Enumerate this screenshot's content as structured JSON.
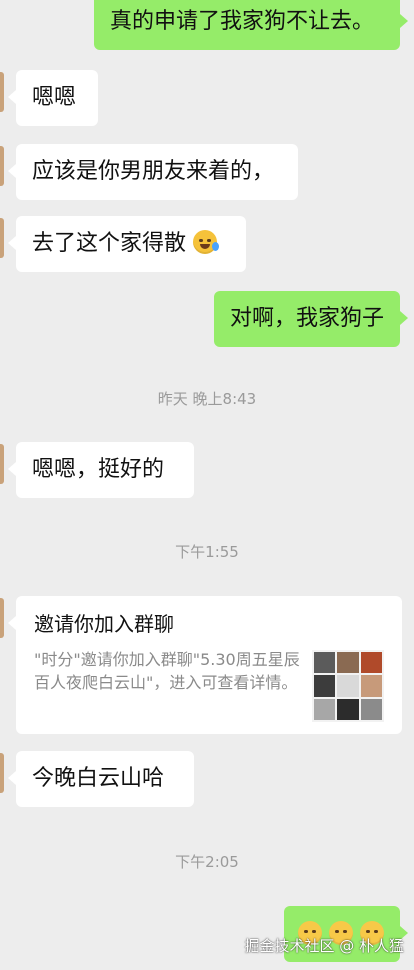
{
  "messages": {
    "m1": "真的申请了我家狗不让去。",
    "m2": "嗯嗯",
    "m3": "应该是你男朋友来着的，",
    "m4": "去了这个家得散",
    "m5": "对啊，我家狗子",
    "m6": "嗯嗯，挺好的",
    "m7": "今晚白云山哈"
  },
  "timestamps": {
    "t1": "昨天 晚上8:43",
    "t2": "下午1:55",
    "t3": "下午2:05"
  },
  "invite_card": {
    "title": "邀请你加入群聊",
    "description": "\"时分\"邀请你加入群聊\"5.30周五星辰百人夜爬白云山\"，进入可查看详情。"
  },
  "watermark": "掘金技术社区 @ 朴人猛",
  "colors": {
    "background": "#ededed",
    "incoming_bubble": "#ffffff",
    "outgoing_bubble": "#95ec69",
    "timestamp_text": "#9a9a9a"
  },
  "icons": {
    "laugh_emoji": "laughing-tears-emoji-icon",
    "emoji_row": "flushed-face-emoji-icon"
  }
}
